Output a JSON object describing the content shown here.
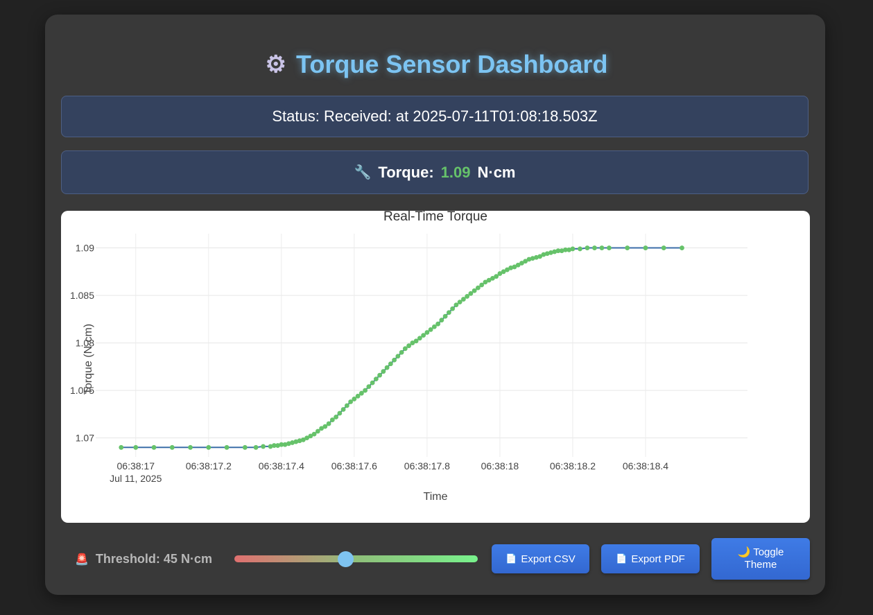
{
  "header": {
    "title": "Torque Sensor Dashboard",
    "icon": "gear-icon"
  },
  "status": {
    "text": "Status: Received: at 2025-07-11T01:08:18.503Z"
  },
  "torque": {
    "label": "Torque:",
    "value": "1.09",
    "unit": "N·cm",
    "icon": "wrench-icon",
    "value_color": "#66c26a"
  },
  "chart_data": {
    "type": "line",
    "title": "Real-Time Torque",
    "xlabel": "Time",
    "ylabel": "Torque (N·cm)",
    "ylim": [
      1.068,
      1.0915
    ],
    "y_ticks": [
      1.07,
      1.075,
      1.08,
      1.085,
      1.09
    ],
    "y_tick_labels": [
      "1.07",
      "1.075",
      "1.08",
      "1.085",
      "1.09"
    ],
    "x_ticks": [
      17.0,
      17.2,
      17.4,
      17.6,
      17.8,
      18.0,
      18.2,
      18.4
    ],
    "x_tick_labels": [
      "06:38:17",
      "06:38:17.2",
      "06:38:17.4",
      "06:38:17.6",
      "06:38:17.8",
      "06:38:18",
      "06:38:18.2",
      "06:38:18.4"
    ],
    "x_date_label": "Jul 11, 2025",
    "grid": true,
    "line_color": "#3b6ea8",
    "marker_color": "#66c26a",
    "x": [
      16.96,
      17.0,
      17.05,
      17.1,
      17.15,
      17.2,
      17.25,
      17.3,
      17.33,
      17.35,
      17.37,
      17.38,
      17.39,
      17.4,
      17.41,
      17.42,
      17.43,
      17.44,
      17.45,
      17.46,
      17.47,
      17.48,
      17.49,
      17.5,
      17.51,
      17.52,
      17.53,
      17.54,
      17.55,
      17.56,
      17.57,
      17.58,
      17.59,
      17.6,
      17.61,
      17.62,
      17.63,
      17.64,
      17.65,
      17.66,
      17.67,
      17.68,
      17.69,
      17.7,
      17.71,
      17.72,
      17.73,
      17.74,
      17.75,
      17.76,
      17.77,
      17.78,
      17.79,
      17.8,
      17.81,
      17.82,
      17.83,
      17.84,
      17.85,
      17.86,
      17.87,
      17.88,
      17.89,
      17.9,
      17.91,
      17.92,
      17.93,
      17.94,
      17.95,
      17.96,
      17.97,
      17.98,
      17.99,
      18.0,
      18.01,
      18.02,
      18.03,
      18.04,
      18.05,
      18.06,
      18.07,
      18.08,
      18.09,
      18.1,
      18.11,
      18.12,
      18.13,
      18.14,
      18.15,
      18.16,
      18.17,
      18.18,
      18.19,
      18.2,
      18.22,
      18.24,
      18.26,
      18.28,
      18.3,
      18.35,
      18.4,
      18.45,
      18.5
    ],
    "values": [
      1.069,
      1.069,
      1.069,
      1.069,
      1.069,
      1.069,
      1.069,
      1.069,
      1.069,
      1.0691,
      1.0691,
      1.0692,
      1.0692,
      1.0693,
      1.0693,
      1.0694,
      1.0695,
      1.0696,
      1.0697,
      1.0698,
      1.07,
      1.0702,
      1.0704,
      1.0707,
      1.071,
      1.0712,
      1.0715,
      1.0719,
      1.0722,
      1.0726,
      1.073,
      1.0734,
      1.0738,
      1.0741,
      1.0744,
      1.0747,
      1.075,
      1.0754,
      1.0758,
      1.0762,
      1.0766,
      1.077,
      1.0774,
      1.0778,
      1.0782,
      1.0786,
      1.079,
      1.0794,
      1.0797,
      1.08,
      1.0802,
      1.0805,
      1.0808,
      1.0811,
      1.0814,
      1.0817,
      1.082,
      1.0824,
      1.0828,
      1.0832,
      1.0836,
      1.084,
      1.0843,
      1.0846,
      1.0849,
      1.0852,
      1.0855,
      1.0858,
      1.0861,
      1.0864,
      1.0866,
      1.0868,
      1.087,
      1.0873,
      1.0875,
      1.0877,
      1.0879,
      1.088,
      1.0882,
      1.0884,
      1.0886,
      1.0888,
      1.0889,
      1.089,
      1.0891,
      1.0893,
      1.0894,
      1.0895,
      1.0896,
      1.0897,
      1.0897,
      1.0898,
      1.0898,
      1.0899,
      1.0899,
      1.09,
      1.09,
      1.09,
      1.09,
      1.09,
      1.09,
      1.09,
      1.09
    ]
  },
  "controls": {
    "threshold_label": "Threshold: 45 N·cm",
    "threshold_icon": "siren-icon",
    "threshold_value": 45,
    "slider_fraction": 0.45,
    "export_csv": "Export CSV",
    "export_pdf": "Export PDF",
    "toggle_line1": "Toggle",
    "toggle_line2": "Theme",
    "toggle_icon": "moon-icon"
  }
}
